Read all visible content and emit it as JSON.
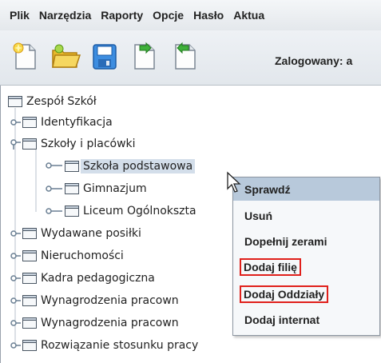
{
  "menubar": {
    "items": [
      "Plik",
      "Narzędzia",
      "Raporty",
      "Opcje",
      "Hasło",
      "Aktua"
    ]
  },
  "toolbar": {
    "buttons": [
      "new-document-icon",
      "open-folder-icon",
      "save-icon",
      "export-icon",
      "import-icon"
    ],
    "login_label": "Zalogowany: a"
  },
  "tree": {
    "root": "Zespół Szkół",
    "items": [
      {
        "label": "Identyfikacja"
      },
      {
        "label": "Szkoły i placówki",
        "children": [
          {
            "label": "Szkoła podstawowa"
          },
          {
            "label": "Gimnazjum"
          },
          {
            "label": "Liceum Ogólnoksztа"
          }
        ]
      },
      {
        "label": "Wydawane posiłki"
      },
      {
        "label": "Nieruchomości"
      },
      {
        "label": "Kadra pedagogiczna"
      },
      {
        "label": "Wynagrodzenia pracown"
      },
      {
        "label": "Wynagrodzenia pracown"
      },
      {
        "label": "Rozwiązanie stosunku pracy"
      }
    ]
  },
  "context_menu": {
    "items": [
      "Sprawdź",
      "Usuń",
      "Dopełnij zerami",
      "Dodaj filię",
      "Dodaj Oddziały",
      "Dodaj internat"
    ],
    "highlight_color": "#e0201b"
  }
}
